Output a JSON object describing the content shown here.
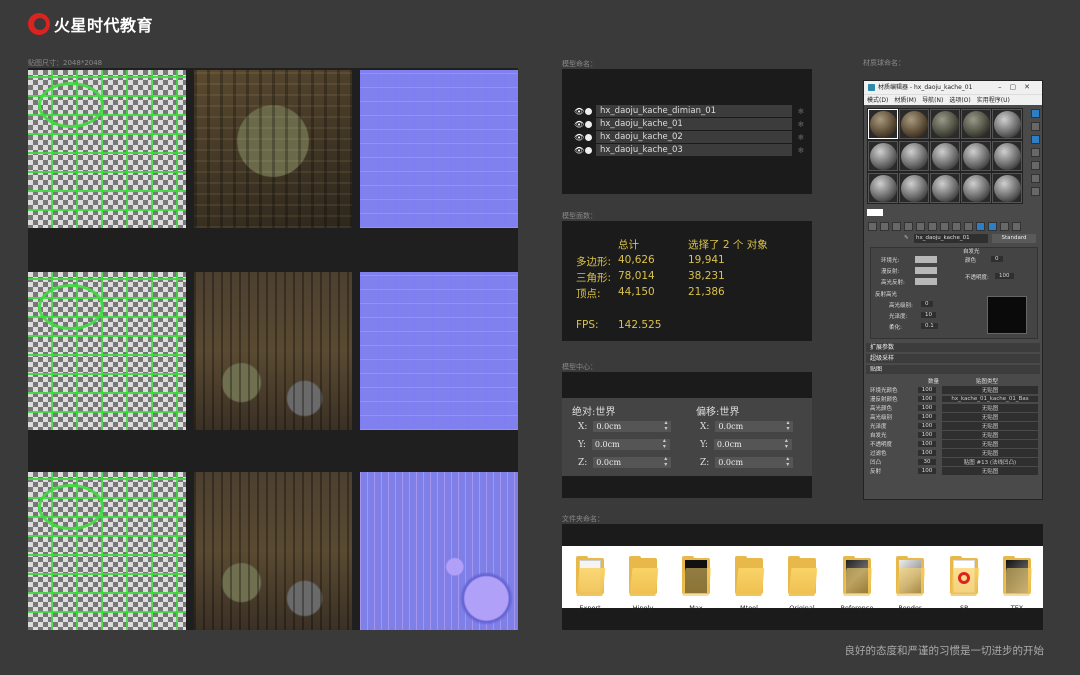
{
  "brand": {
    "name": "火星时代教育",
    "accent": "#dd2222"
  },
  "labels": {
    "texture": "贴图尺寸：2048*2048",
    "layers": "模型命名：",
    "stats": "模型面数：",
    "coords": "模型中心：",
    "material": "材质球命名：",
    "folders": "文件夹命名："
  },
  "layers": [
    {
      "name": "hx_daoju_kache_dimian_01",
      "visible": true
    },
    {
      "name": "hx_daoju_kache_01",
      "visible": true
    },
    {
      "name": "hx_daoju_kache_02",
      "visible": true
    },
    {
      "name": "hx_daoju_kache_03",
      "visible": true
    }
  ],
  "stats": {
    "header_total": "总计",
    "header_selected": "选择了 2 个 对象",
    "rows": [
      {
        "label": "多边形:",
        "total": "40,626",
        "selected": "19,941"
      },
      {
        "label": "三角形:",
        "total": "78,014",
        "selected": "38,231"
      },
      {
        "label": "顶点:",
        "total": "44,150",
        "selected": "21,386"
      }
    ],
    "fps_label": "FPS:",
    "fps_value": "142.525",
    "color": "#d9c24a"
  },
  "coords": {
    "absolute_title": "绝对:世界",
    "offset_title": "偏移:世界",
    "absolute": [
      {
        "axis": "X:",
        "value": "0.0cm"
      },
      {
        "axis": "Y:",
        "value": "0.0cm"
      },
      {
        "axis": "Z:",
        "value": "0.0cm"
      }
    ],
    "offset": [
      {
        "axis": "X:",
        "value": "0.0cm"
      },
      {
        "axis": "Y:",
        "value": "0.0cm"
      },
      {
        "axis": "Z:",
        "value": "0.0cm"
      }
    ]
  },
  "material_editor": {
    "title": "材质编辑器 - hx_daoju_kache_01",
    "menu": [
      "模式(D)",
      "材质(M)",
      "导航(N)",
      "选项(O)",
      "实用程序(U)"
    ],
    "material_name": "hx_daoju_kache_01",
    "material_type": "Standard",
    "section_basic": "明暗器基本参数",
    "ambient": "环境光:",
    "diffuse": "漫反射:",
    "specular": "高光反射:",
    "self_illum": "自发光",
    "color_label": "颜色",
    "color_value": "0",
    "opacity_label": "不透明度:",
    "opacity_value": "100",
    "spec_section": "反射高光",
    "spec_level": "高光级别:",
    "spec_level_value": "0",
    "gloss": "光泽度:",
    "gloss_value": "10",
    "soften": "柔化:",
    "soften_value": "0.1",
    "rollouts": [
      "扩展参数",
      "超级采样",
      "贴图"
    ],
    "map_header_amount": "数量",
    "map_header_type": "贴图类型",
    "maps": [
      {
        "name": "环境光颜色",
        "amount": "100",
        "map": "无贴图"
      },
      {
        "name": "漫反射颜色",
        "amount": "100",
        "map": "hx_kache_01_kache_01_Bas"
      },
      {
        "name": "高光颜色",
        "amount": "100",
        "map": "无贴图"
      },
      {
        "name": "高光级别",
        "amount": "100",
        "map": "无贴图"
      },
      {
        "name": "光泽度",
        "amount": "100",
        "map": "无贴图"
      },
      {
        "name": "自发光",
        "amount": "100",
        "map": "无贴图"
      },
      {
        "name": "不透明度",
        "amount": "100",
        "map": "无贴图"
      },
      {
        "name": "过滤色",
        "amount": "100",
        "map": "无贴图"
      },
      {
        "name": "凹凸",
        "amount": "30",
        "map": "贴图 #13 (法线凹凸)"
      },
      {
        "name": "反射",
        "amount": "100",
        "map": "无贴图"
      }
    ]
  },
  "folders": [
    {
      "name": "Export",
      "content": "doc"
    },
    {
      "name": "Hipoly",
      "content": "empty"
    },
    {
      "name": "Max",
      "content": "dark"
    },
    {
      "name": "Mtool",
      "content": "empty"
    },
    {
      "name": "Original",
      "content": "empty"
    },
    {
      "name": "Reference",
      "content": "dark"
    },
    {
      "name": "Render",
      "content": "doc"
    },
    {
      "name": "SP",
      "content": "red"
    },
    {
      "name": "TEX",
      "content": "dark"
    }
  ],
  "slogan": "良好的态度和严谨的习惯是一切进步的开始"
}
